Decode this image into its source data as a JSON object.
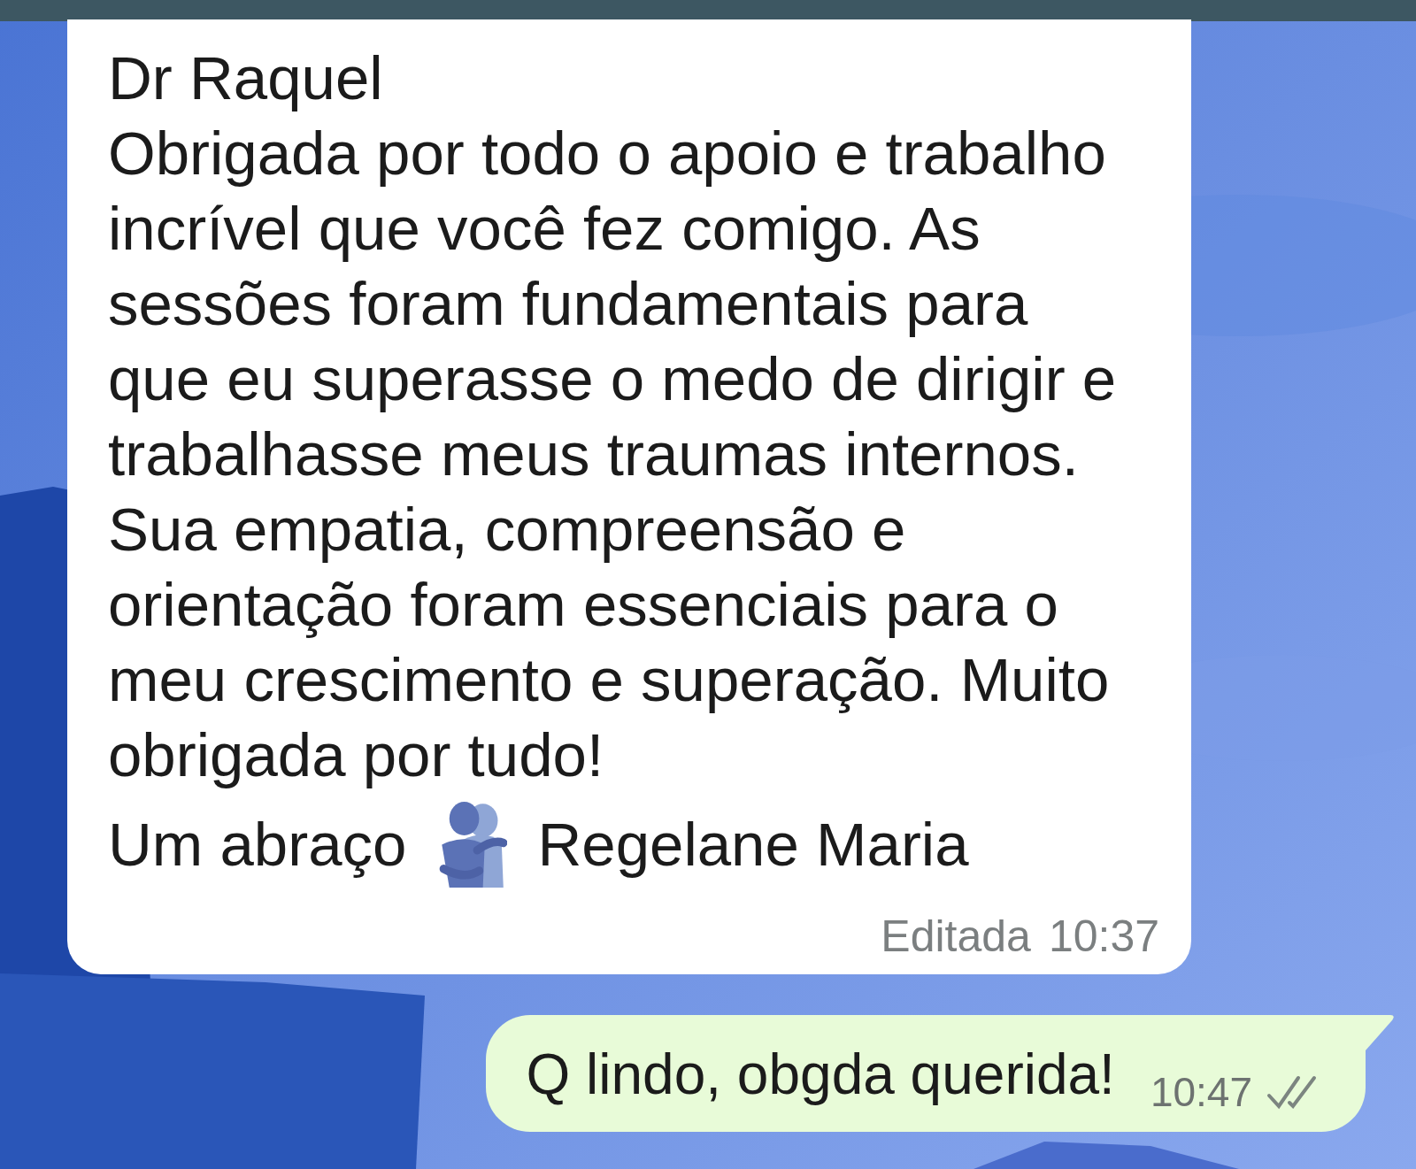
{
  "messages": [
    {
      "kind": "incoming",
      "text": "Dr Raquel\nObrigada por todo o apoio e trabalho\nincrível que você fez comigo. As\nsessões foram fundamentais para\nque eu superasse o medo de dirigir e\ntrabalhasse meus traumas internos.\nSua empatia, compreensão e\norientação foram essenciais para o\nmeu crescimento e superação. Muito\nobrigada por tudo!",
      "closing": "Um abraço",
      "sender": "Regelane Maria",
      "edited_label": "Editada",
      "time": "10:37"
    },
    {
      "kind": "outgoing",
      "text": "Q lindo, obgda querida!",
      "time": "10:47",
      "read": false
    }
  ]
}
